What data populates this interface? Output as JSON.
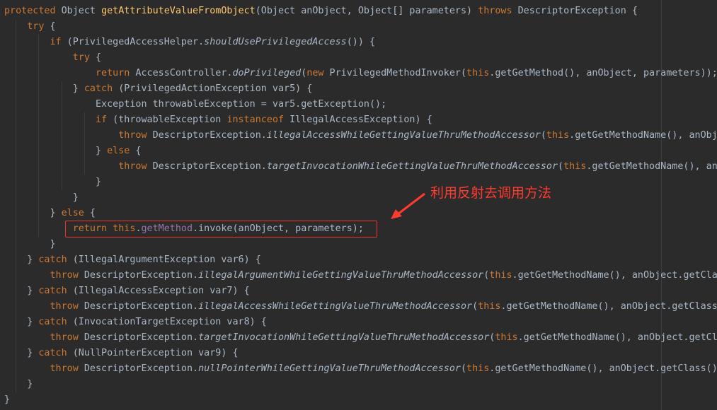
{
  "code_lines": [
    [
      [
        "protected",
        "kw"
      ],
      [
        " Object ",
        ""
      ],
      [
        "getAttributeValueFromObject",
        "fn"
      ],
      [
        "(Object anObject, Object[] parameters) ",
        ""
      ],
      [
        "throws",
        "kw"
      ],
      [
        " DescriptorException {",
        ""
      ]
    ],
    [
      [
        "    ",
        ""
      ],
      [
        "try",
        "kw"
      ],
      [
        " {",
        ""
      ]
    ],
    [
      [
        "        ",
        ""
      ],
      [
        "if",
        "kw"
      ],
      [
        " (PrivilegedAccessHelper.",
        ""
      ],
      [
        "shouldUsePrivilegedAccess",
        "it"
      ],
      [
        "()) {",
        ""
      ]
    ],
    [
      [
        "            ",
        ""
      ],
      [
        "try",
        "kw"
      ],
      [
        " {",
        ""
      ]
    ],
    [
      [
        "                ",
        ""
      ],
      [
        "return",
        "kw"
      ],
      [
        " AccessController.",
        ""
      ],
      [
        "doPrivileged",
        "it"
      ],
      [
        "(",
        ""
      ],
      [
        "new",
        "kw"
      ],
      [
        " PrivilegedMethodInvoker(",
        ""
      ],
      [
        "this",
        "kw"
      ],
      [
        ".getGetMethod(), anObject, parameters));",
        ""
      ]
    ],
    [
      [
        "            } ",
        ""
      ],
      [
        "catch",
        "kw"
      ],
      [
        " (PrivilegedActionException var5) {",
        ""
      ]
    ],
    [
      [
        "                Exception throwableException = var5.getException();",
        ""
      ]
    ],
    [
      [
        "                ",
        ""
      ],
      [
        "if",
        "kw"
      ],
      [
        " (throwableException ",
        ""
      ],
      [
        "instanceof",
        "kw"
      ],
      [
        " IllegalAccessException) {",
        ""
      ]
    ],
    [
      [
        "                    ",
        ""
      ],
      [
        "throw",
        "kw"
      ],
      [
        " DescriptorException.",
        ""
      ],
      [
        "illegalAccessWhileGettingValueThruMethodAccessor",
        "it"
      ],
      [
        "(",
        ""
      ],
      [
        "this",
        "kw"
      ],
      [
        ".getGetMethodName(), anObje",
        ""
      ]
    ],
    [
      [
        "                } ",
        ""
      ],
      [
        "else",
        "kw"
      ],
      [
        " {",
        ""
      ]
    ],
    [
      [
        "                    ",
        ""
      ],
      [
        "throw",
        "kw"
      ],
      [
        " DescriptorException.",
        ""
      ],
      [
        "targetInvocationWhileGettingValueThruMethodAccessor",
        "it"
      ],
      [
        "(",
        ""
      ],
      [
        "this",
        "kw"
      ],
      [
        ".getGetMethodName(), anOb",
        ""
      ]
    ],
    [
      [
        "                }",
        ""
      ]
    ],
    [
      [
        "            }",
        ""
      ]
    ],
    [
      [
        "        } ",
        ""
      ],
      [
        "else",
        "kw"
      ],
      [
        " {",
        ""
      ]
    ],
    [
      [
        "            ",
        ""
      ],
      [
        "return",
        "kw"
      ],
      [
        " ",
        ""
      ],
      [
        "this",
        "kw"
      ],
      [
        ".",
        ""
      ],
      [
        "getMethod",
        "fld"
      ],
      [
        ".invoke(anObject, parameters);",
        ""
      ]
    ],
    [
      [
        "        }",
        ""
      ]
    ],
    [
      [
        "    } ",
        ""
      ],
      [
        "catch",
        "kw"
      ],
      [
        " (IllegalArgumentException var6) {",
        ""
      ]
    ],
    [
      [
        "        ",
        ""
      ],
      [
        "throw",
        "kw"
      ],
      [
        " DescriptorException.",
        ""
      ],
      [
        "illegalArgumentWhileGettingValueThruMethodAccessor",
        "it"
      ],
      [
        "(",
        ""
      ],
      [
        "this",
        "kw"
      ],
      [
        ".getGetMethodName(), anObject.getClass",
        ""
      ]
    ],
    [
      [
        "    } ",
        ""
      ],
      [
        "catch",
        "kw"
      ],
      [
        " (IllegalAccessException var7) {",
        ""
      ]
    ],
    [
      [
        "        ",
        ""
      ],
      [
        "throw",
        "kw"
      ],
      [
        " DescriptorException.",
        ""
      ],
      [
        "illegalAccessWhileGettingValueThruMethodAccessor",
        "it"
      ],
      [
        "(",
        ""
      ],
      [
        "this",
        "kw"
      ],
      [
        ".getGetMethodName(), anObject.getClass(",
        ""
      ]
    ],
    [
      [
        "    } ",
        ""
      ],
      [
        "catch",
        "kw"
      ],
      [
        " (InvocationTargetException var8) {",
        ""
      ]
    ],
    [
      [
        "        ",
        ""
      ],
      [
        "throw",
        "kw"
      ],
      [
        " DescriptorException.",
        ""
      ],
      [
        "targetInvocationWhileGettingValueThruMethodAccessor",
        "it"
      ],
      [
        "(",
        ""
      ],
      [
        "this",
        "kw"
      ],
      [
        ".getGetMethodName(), anObject.getCla",
        ""
      ]
    ],
    [
      [
        "    } ",
        ""
      ],
      [
        "catch",
        "kw"
      ],
      [
        " (NullPointerException var9) {",
        ""
      ]
    ],
    [
      [
        "        ",
        ""
      ],
      [
        "throw",
        "kw"
      ],
      [
        " DescriptorException.",
        ""
      ],
      [
        "nullPointerWhileGettingValueThruMethodAccessor",
        "it"
      ],
      [
        "(",
        ""
      ],
      [
        "this",
        "kw"
      ],
      [
        ".getGetMethodName(), anObject.getClass().",
        ""
      ]
    ],
    [
      [
        "    }",
        ""
      ]
    ],
    [
      [
        "}",
        ""
      ]
    ]
  ],
  "annotation": {
    "text": "利用反射去调用方法",
    "color": "#ff3b30"
  },
  "colors": {
    "background": "#2b2b2b",
    "text": "#a9b7c6",
    "keyword": "#cc7832",
    "function": "#ffc66d",
    "field": "#9876aa",
    "highlight_box": "#e8382d"
  }
}
